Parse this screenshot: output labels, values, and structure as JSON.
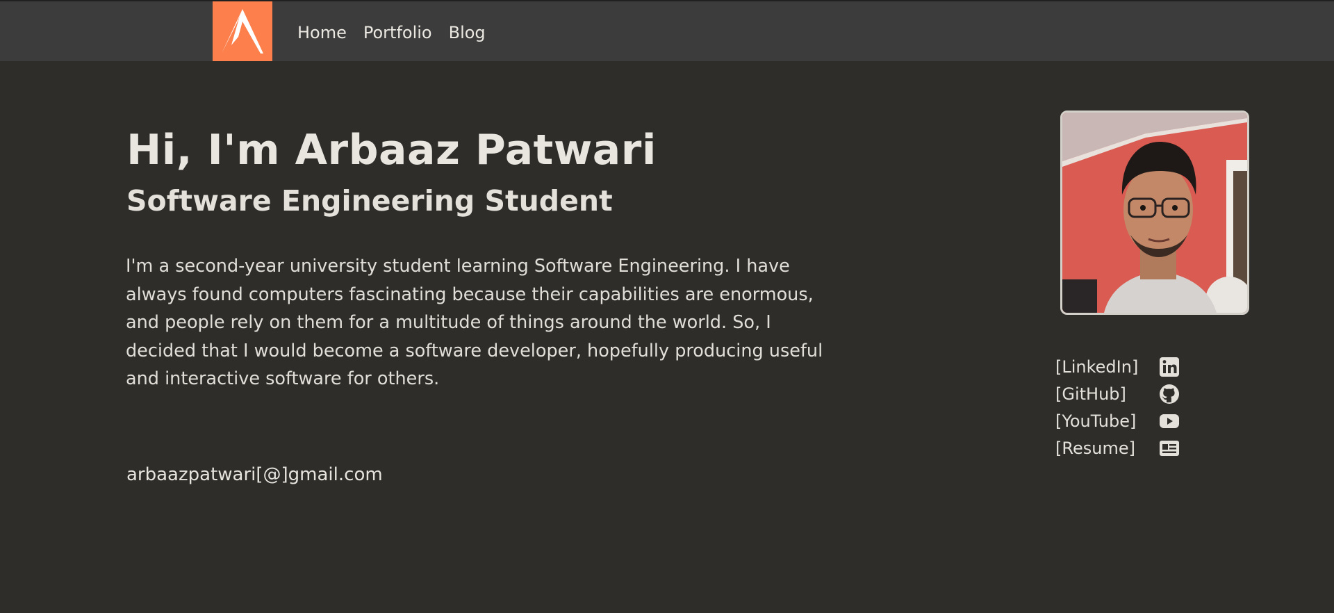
{
  "nav": {
    "logo_alt": "logo",
    "links": [
      "Home",
      "Portfolio",
      "Blog"
    ]
  },
  "hero": {
    "title": "Hi, I'm Arbaaz Patwari",
    "subtitle": "Software Engineering Student",
    "bio": "I'm a second-year university student learning Software Engineering. I have always found computers fascinating because their capabilities are enormous, and people rely on them for a multitude of things around the world. So, I decided that I would become a software developer, hopefully producing useful and interactive software for others.",
    "email": "arbaazpatwari[@]gmail.com"
  },
  "social": [
    {
      "label": "[LinkedIn]",
      "icon": "linkedin-icon"
    },
    {
      "label": "[GitHub]",
      "icon": "github-icon"
    },
    {
      "label": "[YouTube]",
      "icon": "youtube-icon"
    },
    {
      "label": "[Resume]",
      "icon": "resume-icon"
    }
  ],
  "colors": {
    "background": "#2e2d2a",
    "navbar": "#3c3c3c",
    "accent": "#fc7f4c",
    "text": "#e4e2dd"
  }
}
